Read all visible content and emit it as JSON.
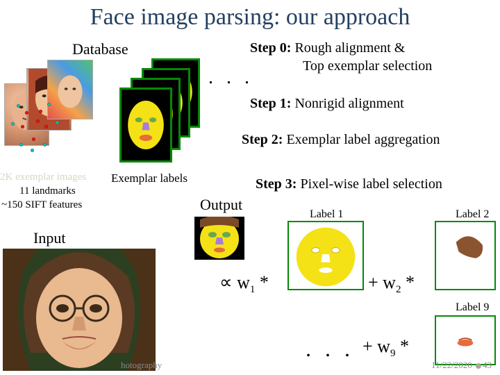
{
  "title": "Face image parsing: our approach",
  "labels": {
    "database": "Database",
    "input": "Input",
    "exemplar_labels": "Exemplar labels",
    "output": "Output"
  },
  "info": {
    "line1": "2K exemplar images",
    "line2": "11  landmarks",
    "line3": "~150  SIFT features"
  },
  "steps": {
    "s0b": "Step 0:",
    "s0t1": " Rough alignment &",
    "s0t2": "Top exemplar selection",
    "s1b": "Step 1:",
    "s1t": " Nonrigid alignment",
    "s2b": "Step 2:",
    "s2t": " Exemplar label aggregation",
    "s3b": "Step 3:",
    "s3t": " Pixel-wise label selection"
  },
  "formula": {
    "prop_part1": "∝ w",
    "sub1": "1",
    "star": " *",
    "plus_w2": "+ w",
    "sub2": "2",
    "plus_w9": "+  w",
    "sub9": "9"
  },
  "labeltitles": {
    "l1": "Label 1",
    "l2": "Label 2",
    "l9": "Label 9"
  },
  "footer": {
    "left": "hotography",
    "date": "11/22/2020",
    "page": "43"
  },
  "ellipsis": ". . .",
  "ellipsis2": ". . ."
}
